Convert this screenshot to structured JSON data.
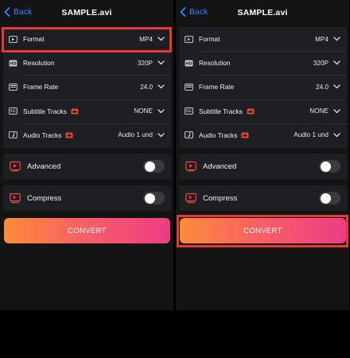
{
  "nav": {
    "back_label": "Back",
    "title": "SAMPLE.avi"
  },
  "settings": [
    {
      "id": "format",
      "label": "Format",
      "value": "MP4",
      "icon": "film-icon",
      "badge": false
    },
    {
      "id": "resolution",
      "label": "Resolution",
      "value": "320P",
      "icon": "hd-icon",
      "badge": false
    },
    {
      "id": "frame-rate",
      "label": "Frame Rate",
      "value": "24.0",
      "icon": "frame-rate-icon",
      "badge": false
    },
    {
      "id": "subtitle-tracks",
      "label": "Subtitle Tracks",
      "value": "NONE",
      "icon": "cc-icon",
      "badge": true
    },
    {
      "id": "audio-tracks",
      "label": "Audio Tracks",
      "value": "Audio 1 und",
      "icon": "music-icon",
      "badge": true
    }
  ],
  "advanced": {
    "label": "Advanced",
    "enabled": false,
    "icon": "advanced-icon"
  },
  "compress": {
    "label": "Compress",
    "enabled": false,
    "icon": "compress-icon"
  },
  "convert_label": "CONVERT",
  "colors": {
    "accent_blue": "#2f87ff",
    "highlight_red": "#e53935",
    "gradient_start": "#fb8b3a",
    "gradient_end": "#ef3c86",
    "background": "#141414",
    "group_bg": "#1e1f22"
  },
  "highlights": {
    "left_panel": "format-row",
    "right_panel": "convert-button"
  }
}
